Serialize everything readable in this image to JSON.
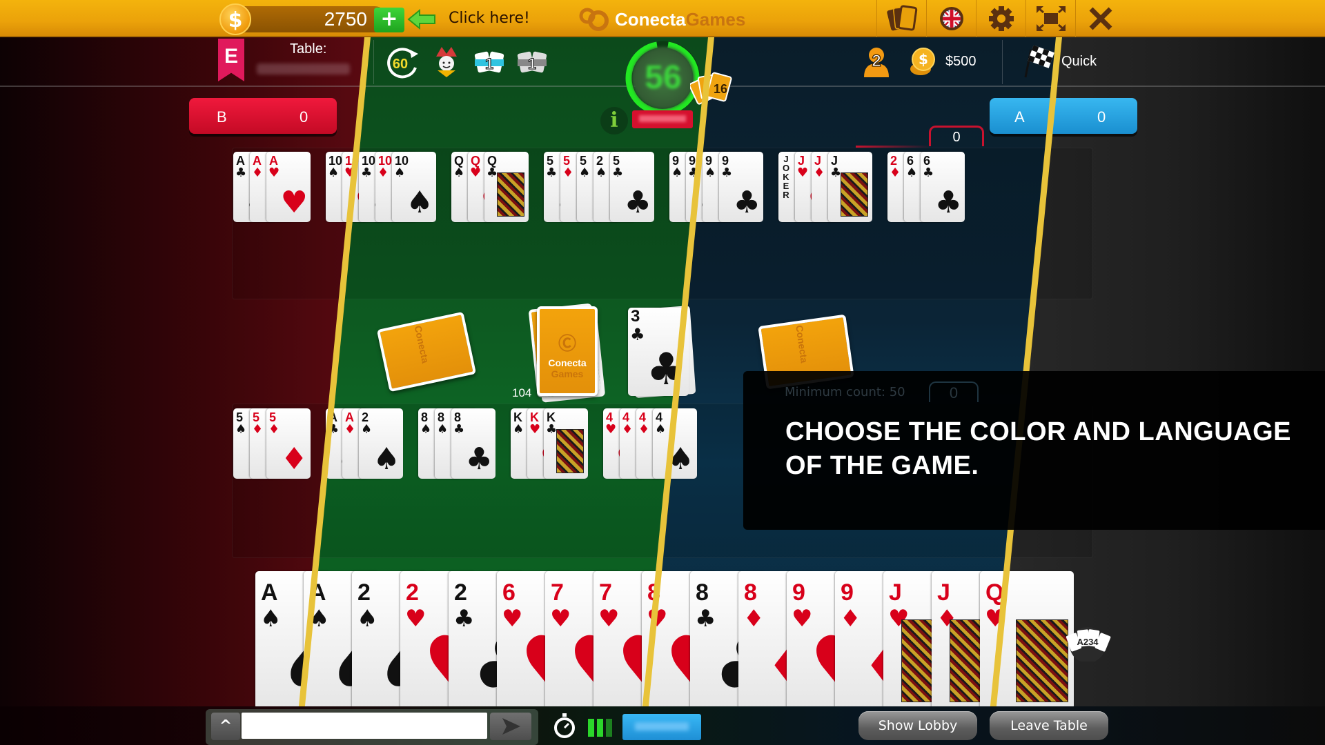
{
  "topbar": {
    "coin_symbol": "$",
    "coins": "2750",
    "add_label": "+",
    "promo_text": "Click here!",
    "logo_part1": "Conecta",
    "logo_part2": "Games",
    "buttons": [
      {
        "name": "card-deck-style",
        "icon": "card-deck-icon"
      },
      {
        "name": "language",
        "icon": "uk-flag-icon"
      },
      {
        "name": "settings",
        "icon": "gear-icon"
      },
      {
        "name": "fullscreen",
        "icon": "fullscreen-icon"
      },
      {
        "name": "close",
        "icon": "close-icon"
      }
    ]
  },
  "infobar": {
    "level_badge": "E",
    "table_label": "Table:",
    "turn_time": "60",
    "melds_team_count": "1",
    "melds_other_count": "1",
    "player_avatar_text": "56",
    "opponent_hand_count": "16",
    "info_label": "i",
    "players_count": "2",
    "bet_amount": "$500",
    "game_mode": "Quick"
  },
  "teams": {
    "b": {
      "name": "B",
      "score": "0"
    },
    "a": {
      "name": "A",
      "score": "0",
      "meld_points": "0"
    }
  },
  "top_melds": [
    [
      {
        "r": "A",
        "s": "♣",
        "c": "blk"
      },
      {
        "r": "A",
        "s": "♦",
        "c": "red"
      },
      {
        "r": "A",
        "s": "♥",
        "c": "red"
      }
    ],
    [
      {
        "r": "10",
        "s": "♠",
        "c": "blk"
      },
      {
        "r": "10",
        "s": "♥",
        "c": "red"
      },
      {
        "r": "10",
        "s": "♣",
        "c": "blk"
      },
      {
        "r": "10",
        "s": "♦",
        "c": "red"
      },
      {
        "r": "10",
        "s": "♠",
        "c": "blk"
      }
    ],
    [
      {
        "r": "Q",
        "s": "♠",
        "c": "blk"
      },
      {
        "r": "Q",
        "s": "♥",
        "c": "red"
      },
      {
        "r": "Q",
        "s": "♣",
        "c": "blk",
        "face": true
      }
    ],
    [
      {
        "r": "5",
        "s": "♣",
        "c": "blk"
      },
      {
        "r": "5",
        "s": "♦",
        "c": "red"
      },
      {
        "r": "5",
        "s": "♠",
        "c": "blk"
      },
      {
        "r": "2",
        "s": "♠",
        "c": "blk"
      },
      {
        "r": "5",
        "s": "♣",
        "c": "blk"
      }
    ],
    [
      {
        "r": "9",
        "s": "♠",
        "c": "blk"
      },
      {
        "r": "9",
        "s": "♣",
        "c": "blk"
      },
      {
        "r": "9",
        "s": "♠",
        "c": "blk"
      },
      {
        "r": "9",
        "s": "♣",
        "c": "blk"
      }
    ],
    [
      {
        "r": "JOKER",
        "s": "",
        "c": "blk",
        "joker": true
      },
      {
        "r": "J",
        "s": "♥",
        "c": "red"
      },
      {
        "r": "J",
        "s": "♦",
        "c": "red"
      },
      {
        "r": "J",
        "s": "♣",
        "c": "blk",
        "face": true
      }
    ],
    [
      {
        "r": "2",
        "s": "♦",
        "c": "red"
      },
      {
        "r": "6",
        "s": "♠",
        "c": "blk"
      },
      {
        "r": "6",
        "s": "♣",
        "c": "blk"
      }
    ]
  ],
  "bottom_melds": [
    [
      {
        "r": "5",
        "s": "♠",
        "c": "blk"
      },
      {
        "r": "5",
        "s": "♦",
        "c": "red"
      },
      {
        "r": "5",
        "s": "♦",
        "c": "red"
      }
    ],
    [
      {
        "r": "A",
        "s": "♣",
        "c": "blk"
      },
      {
        "r": "A",
        "s": "♦",
        "c": "red"
      },
      {
        "r": "2",
        "s": "♠",
        "c": "blk"
      }
    ],
    [
      {
        "r": "8",
        "s": "♠",
        "c": "blk"
      },
      {
        "r": "8",
        "s": "♠",
        "c": "blk"
      },
      {
        "r": "8",
        "s": "♣",
        "c": "blk"
      }
    ],
    [
      {
        "r": "K",
        "s": "♠",
        "c": "blk"
      },
      {
        "r": "K",
        "s": "♥",
        "c": "red"
      },
      {
        "r": "K",
        "s": "♣",
        "c": "blk",
        "face": true
      }
    ],
    [
      {
        "r": "4",
        "s": "♥",
        "c": "red"
      },
      {
        "r": "4",
        "s": "♦",
        "c": "red"
      },
      {
        "r": "4",
        "s": "♦",
        "c": "red"
      },
      {
        "r": "4",
        "s": "♠",
        "c": "blk"
      }
    ]
  ],
  "center": {
    "deck_count": "104",
    "discard_top": {
      "r": "3",
      "s": "♣",
      "c": "blk"
    },
    "card_back_brand1": "Conecta",
    "card_back_brand2": "Games"
  },
  "tutorial": {
    "min_count": "Minimum count: 50",
    "points": "0",
    "message": "CHOOSE THE COLOR AND LANGUAGE OF THE GAME."
  },
  "hand": [
    {
      "r": "A",
      "s": "♠",
      "c": "blk"
    },
    {
      "r": "A",
      "s": "♠",
      "c": "blk"
    },
    {
      "r": "2",
      "s": "♠",
      "c": "blk"
    },
    {
      "r": "2",
      "s": "♥",
      "c": "red"
    },
    {
      "r": "2",
      "s": "♣",
      "c": "blk"
    },
    {
      "r": "6",
      "s": "♥",
      "c": "red"
    },
    {
      "r": "7",
      "s": "♥",
      "c": "red"
    },
    {
      "r": "7",
      "s": "♥",
      "c": "red"
    },
    {
      "r": "8",
      "s": "♥",
      "c": "red"
    },
    {
      "r": "8",
      "s": "♣",
      "c": "blk"
    },
    {
      "r": "8",
      "s": "♦",
      "c": "red"
    },
    {
      "r": "9",
      "s": "♥",
      "c": "red"
    },
    {
      "r": "9",
      "s": "♦",
      "c": "red"
    },
    {
      "r": "J",
      "s": "♥",
      "c": "red",
      "face": true
    },
    {
      "r": "J",
      "s": "♦",
      "c": "red",
      "face": true
    },
    {
      "r": "Q",
      "s": "♥",
      "c": "red",
      "face": true
    }
  ],
  "sort_label": "A234",
  "bottombar": {
    "chat_toggle": "^",
    "chat_placeholder": "",
    "show_lobby": "Show Lobby",
    "leave_table": "Leave Table"
  },
  "colors": {
    "accent_orange": "#f4b30c",
    "team_b": "#e0132f",
    "team_a": "#2aa5e6",
    "stripe_yellow": "#e8c33a",
    "timer_green": "#22e822"
  }
}
